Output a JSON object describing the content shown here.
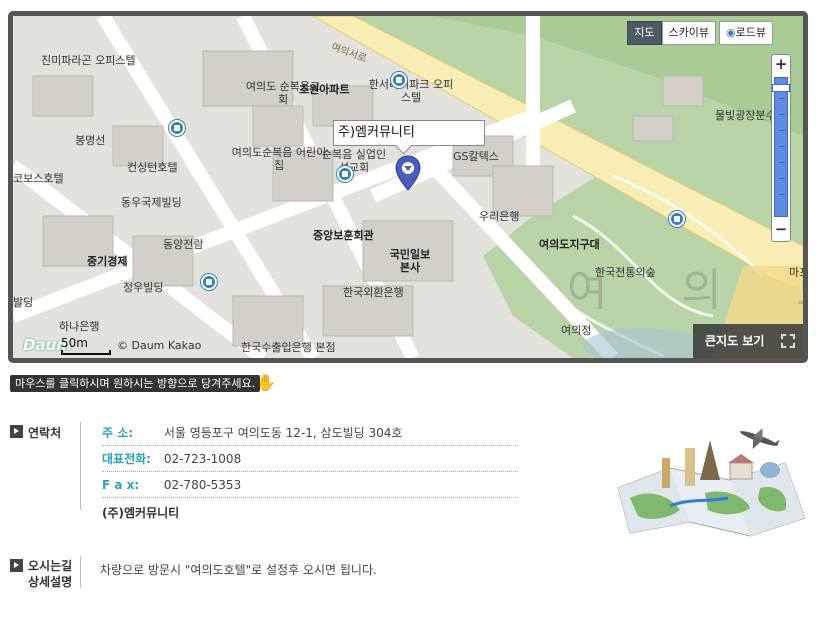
{
  "map": {
    "type_buttons": [
      "지도",
      "스카이뷰",
      "로드뷰"
    ],
    "active_type": "지도",
    "zoom": {
      "in": "+",
      "out": "−",
      "level_fraction": 0.05
    },
    "callout_label": "주)엠커뮤니티",
    "bigmap_button": "큰지도 보기",
    "scale_label": "50m",
    "copyright": "© Daum Kakao",
    "logo": "Daum",
    "area_label": "여 의 도",
    "road_label": "여의서로",
    "places": [
      "진미파라곤 오피스텔",
      "봉명선",
      "컨싱턴호텔",
      "코보스호텔",
      "동우국제빌딩",
      "동양전람",
      "중기경제",
      "정우빌딩",
      "하나은행",
      "발딩",
      "여의도 순복음교회",
      "초원아파트",
      "한서리버파크 오피스텔",
      "여의도순복음 어린이집",
      "순복음 실업인선교회",
      "GS칼텍스",
      "중앙보훈회관",
      "우리은행",
      "국민일보 본사",
      "한국외환은행",
      "여의도지구대",
      "한국전통의숲",
      "물빛광장분수",
      "여의정",
      "한국수출입은행 본점",
      "마포"
    ],
    "colors": {
      "road": "#ffffff",
      "park": "#b8d4a6",
      "block": "#d8d6d0",
      "building": "#c9c7c1",
      "main_road": "#f6e9a8",
      "bus": "#3a7fb4",
      "pin": "#4a5db8"
    }
  },
  "hint": "마우스를 클릭하시며 원하시는 방향으로 당겨주세요.",
  "contact": {
    "section_title": "연락처",
    "address_key": "주    소:",
    "address": "서울 영등포구 여의도동 12-1, 삼도빌딩 304호",
    "phone_key": "대표전화:",
    "phone": "02-723-1008",
    "fax_key": "F  a  x:",
    "fax": "02-780-5353",
    "company": "(주)엠커뮤니티"
  },
  "directions": {
    "section_title_1": "오시는길",
    "section_title_2": "상세설명",
    "text": "차량으로 방문시 \"여의도호텔\"로 설정후 오시면 됩니다."
  }
}
